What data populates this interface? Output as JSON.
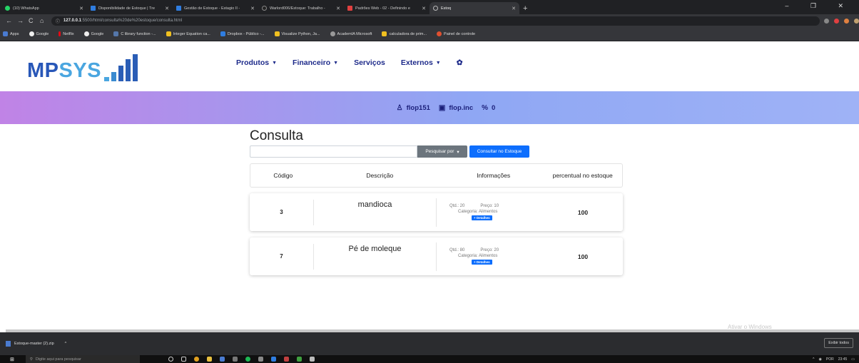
{
  "browser": {
    "tabs": [
      {
        "label": "(10) WhatsApp",
        "color": "#25d366",
        "active": false
      },
      {
        "label": "Disponibilidade de Estoque | Tre",
        "color": "#2f7de0",
        "active": false
      },
      {
        "label": "Gestão de Estoque - Estagio II - ",
        "color": "#2f7de0",
        "active": false
      },
      {
        "label": "Warlord006/Estoque: Trabalho - ",
        "color": "#888888",
        "active": false
      },
      {
        "label": "Padrões Web - 02 - Definindo e ",
        "color": "#e04040",
        "active": false
      },
      {
        "label": "Estoq",
        "color": "#bbbbbb",
        "active": true
      }
    ],
    "newtab": "+",
    "window_controls": "– ❐ ✕",
    "nav": [
      "←",
      "→",
      "C",
      "⌂"
    ],
    "url_host": "127.0.0.1",
    "url_rest": ":5500/html/consulta%20de%20estoque/consulta.html",
    "bookmarks": [
      {
        "label": "Apps",
        "color": "#4a7bd0"
      },
      {
        "label": "Google",
        "color": "#eeeeee"
      },
      {
        "label": "Netflix",
        "color": "#e50914"
      },
      {
        "label": "Google",
        "color": "#eeeeee"
      },
      {
        "label": "C library function -...",
        "color": "#5577aa"
      },
      {
        "label": "Integer Equation ca...",
        "color": "#f0c020"
      },
      {
        "label": "Dropbox - Público -...",
        "color": "#2f7de0"
      },
      {
        "label": "Visualize Python, Ja...",
        "color": "#f0c020"
      },
      {
        "label": "AcademIA Microsoft",
        "color": "#999999"
      },
      {
        "label": "calculadora de prim...",
        "color": "#f0c020"
      },
      {
        "label": "Painel de controle",
        "color": "#e05030"
      }
    ]
  },
  "site": {
    "logo_mp": "MP",
    "logo_sys": "SYS",
    "nav": [
      {
        "label": "Produtos",
        "caret": "▼"
      },
      {
        "label": "Financeiro",
        "caret": "▼"
      },
      {
        "label": "Serviços",
        "caret": ""
      },
      {
        "label": "Externos",
        "caret": "▼"
      }
    ],
    "settings_icon": "✿",
    "banner": {
      "user": "flop151",
      "company": "flop.inc",
      "percent": "0"
    }
  },
  "consulta": {
    "title": "Consulta",
    "search_value": "",
    "search_by": "Pesquisar por",
    "search_by_caret": "▾",
    "submit": "Consultar no Estoque",
    "headers": [
      "Código",
      "Descrição",
      "Informações",
      "percentual no estoque"
    ],
    "rows": [
      {
        "code": "3",
        "desc": "mandioca",
        "qtd": "Qtd.: 20",
        "preco": "Preço: 10",
        "categoria": "Categoria: Alimentos",
        "detalhes": "+ Detalhes",
        "percentual": "100"
      },
      {
        "code": "7",
        "desc": "Pé de moleque",
        "qtd": "Qtd.: 80",
        "preco": "Preço: 20",
        "categoria": "Categoria: Alimentos",
        "detalhes": "+ Detalhes",
        "percentual": "100"
      }
    ]
  },
  "windows": {
    "watermark": "Ativar o Windows",
    "download_file": "Estoque-master (2).zip",
    "download_caret": "^",
    "show_all": "Exibir todos",
    "start_icon": "⊞",
    "search_placeholder": "Digite aqui para pesquisar",
    "tray_lang": "POR",
    "tray_time": "23:45"
  }
}
